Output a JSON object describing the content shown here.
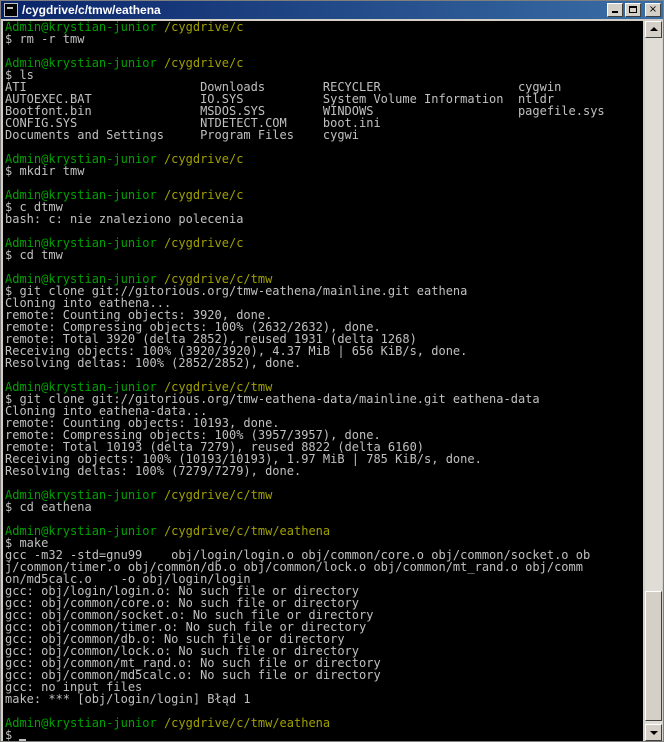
{
  "window": {
    "title": "/cygdrive/c/tmw/eathena",
    "buttons": {
      "minimize": "_",
      "maximize": "□",
      "close": "×"
    }
  },
  "terminal": {
    "lines": [
      {
        "t": "prompt",
        "user": "Admin@krystian-junior",
        "path": "/cygdrive/c"
      },
      {
        "t": "cmd",
        "text": "$ rm -r tmw"
      },
      {
        "t": "blank"
      },
      {
        "t": "prompt",
        "user": "Admin@krystian-junior",
        "path": "/cygdrive/c"
      },
      {
        "t": "cmd",
        "text": "$ ls"
      },
      {
        "t": "out",
        "text": "ATI                        Downloads        RECYCLER                   cygwin"
      },
      {
        "t": "out",
        "text": "AUTOEXEC.BAT               IO.SYS           System Volume Information  ntldr"
      },
      {
        "t": "out",
        "text": "Bootfont.bin               MSDOS.SYS        WINDOWS                    pagefile.sys"
      },
      {
        "t": "out",
        "text": "CONFIG.SYS                 NTDETECT.COM     boot.ini"
      },
      {
        "t": "out",
        "text": "Documents and Settings     Program Files    cygwi"
      },
      {
        "t": "blank"
      },
      {
        "t": "prompt",
        "user": "Admin@krystian-junior",
        "path": "/cygdrive/c"
      },
      {
        "t": "cmd",
        "text": "$ mkdir tmw"
      },
      {
        "t": "blank"
      },
      {
        "t": "prompt",
        "user": "Admin@krystian-junior",
        "path": "/cygdrive/c"
      },
      {
        "t": "cmd",
        "text": "$ c dtmw"
      },
      {
        "t": "out",
        "text": "bash: c: nie znaleziono polecenia"
      },
      {
        "t": "blank"
      },
      {
        "t": "prompt",
        "user": "Admin@krystian-junior",
        "path": "/cygdrive/c"
      },
      {
        "t": "cmd",
        "text": "$ cd tmw"
      },
      {
        "t": "blank"
      },
      {
        "t": "prompt",
        "user": "Admin@krystian-junior",
        "path": "/cygdrive/c/tmw"
      },
      {
        "t": "cmd",
        "text": "$ git clone git://gitorious.org/tmw-eathena/mainline.git eathena"
      },
      {
        "t": "out",
        "text": "Cloning into eathena..."
      },
      {
        "t": "out",
        "text": "remote: Counting objects: 3920, done."
      },
      {
        "t": "out",
        "text": "remote: Compressing objects: 100% (2632/2632), done."
      },
      {
        "t": "out",
        "text": "remote: Total 3920 (delta 2852), reused 1931 (delta 1268)"
      },
      {
        "t": "out",
        "text": "Receiving objects: 100% (3920/3920), 4.37 MiB | 656 KiB/s, done."
      },
      {
        "t": "out",
        "text": "Resolving deltas: 100% (2852/2852), done."
      },
      {
        "t": "blank"
      },
      {
        "t": "prompt",
        "user": "Admin@krystian-junior",
        "path": "/cygdrive/c/tmw"
      },
      {
        "t": "cmd",
        "text": "$ git clone git://gitorious.org/tmw-eathena-data/mainline.git eathena-data"
      },
      {
        "t": "out",
        "text": "Cloning into eathena-data..."
      },
      {
        "t": "out",
        "text": "remote: Counting objects: 10193, done."
      },
      {
        "t": "out",
        "text": "remote: Compressing objects: 100% (3957/3957), done."
      },
      {
        "t": "out",
        "text": "remote: Total 10193 (delta 7279), reused 8822 (delta 6160)"
      },
      {
        "t": "out",
        "text": "Receiving objects: 100% (10193/10193), 1.97 MiB | 785 KiB/s, done."
      },
      {
        "t": "out",
        "text": "Resolving deltas: 100% (7279/7279), done."
      },
      {
        "t": "blank"
      },
      {
        "t": "prompt",
        "user": "Admin@krystian-junior",
        "path": "/cygdrive/c/tmw"
      },
      {
        "t": "cmd",
        "text": "$ cd eathena"
      },
      {
        "t": "blank"
      },
      {
        "t": "prompt",
        "user": "Admin@krystian-junior",
        "path": "/cygdrive/c/tmw/eathena"
      },
      {
        "t": "cmd",
        "text": "$ make"
      },
      {
        "t": "out",
        "text": "gcc -m32 -std=gnu99    obj/login/login.o obj/common/core.o obj/common/socket.o ob"
      },
      {
        "t": "out",
        "text": "j/common/timer.o obj/common/db.o obj/common/lock.o obj/common/mt_rand.o obj/comm"
      },
      {
        "t": "out",
        "text": "on/md5calc.o    -o obj/login/login"
      },
      {
        "t": "out",
        "text": "gcc: obj/login/login.o: No such file or directory"
      },
      {
        "t": "out",
        "text": "gcc: obj/common/core.o: No such file or directory"
      },
      {
        "t": "out",
        "text": "gcc: obj/common/socket.o: No such file or directory"
      },
      {
        "t": "out",
        "text": "gcc: obj/common/timer.o: No such file or directory"
      },
      {
        "t": "out",
        "text": "gcc: obj/common/db.o: No such file or directory"
      },
      {
        "t": "out",
        "text": "gcc: obj/common/lock.o: No such file or directory"
      },
      {
        "t": "out",
        "text": "gcc: obj/common/mt_rand.o: No such file or directory"
      },
      {
        "t": "out",
        "text": "gcc: obj/common/md5calc.o: No such file or directory"
      },
      {
        "t": "out",
        "text": "gcc: no input files"
      },
      {
        "t": "out",
        "text": "make: *** [obj/login/login] Błąd 1"
      },
      {
        "t": "blank"
      },
      {
        "t": "prompt",
        "user": "Admin@krystian-junior",
        "path": "/cygdrive/c/tmw/eathena"
      },
      {
        "t": "cursor",
        "text": "$ "
      }
    ]
  },
  "colors": {
    "background": "#000000",
    "text": "#c0c0c0",
    "prompt_user": "#00a000",
    "prompt_path": "#a0a000",
    "titlebar": "#0a246a"
  }
}
